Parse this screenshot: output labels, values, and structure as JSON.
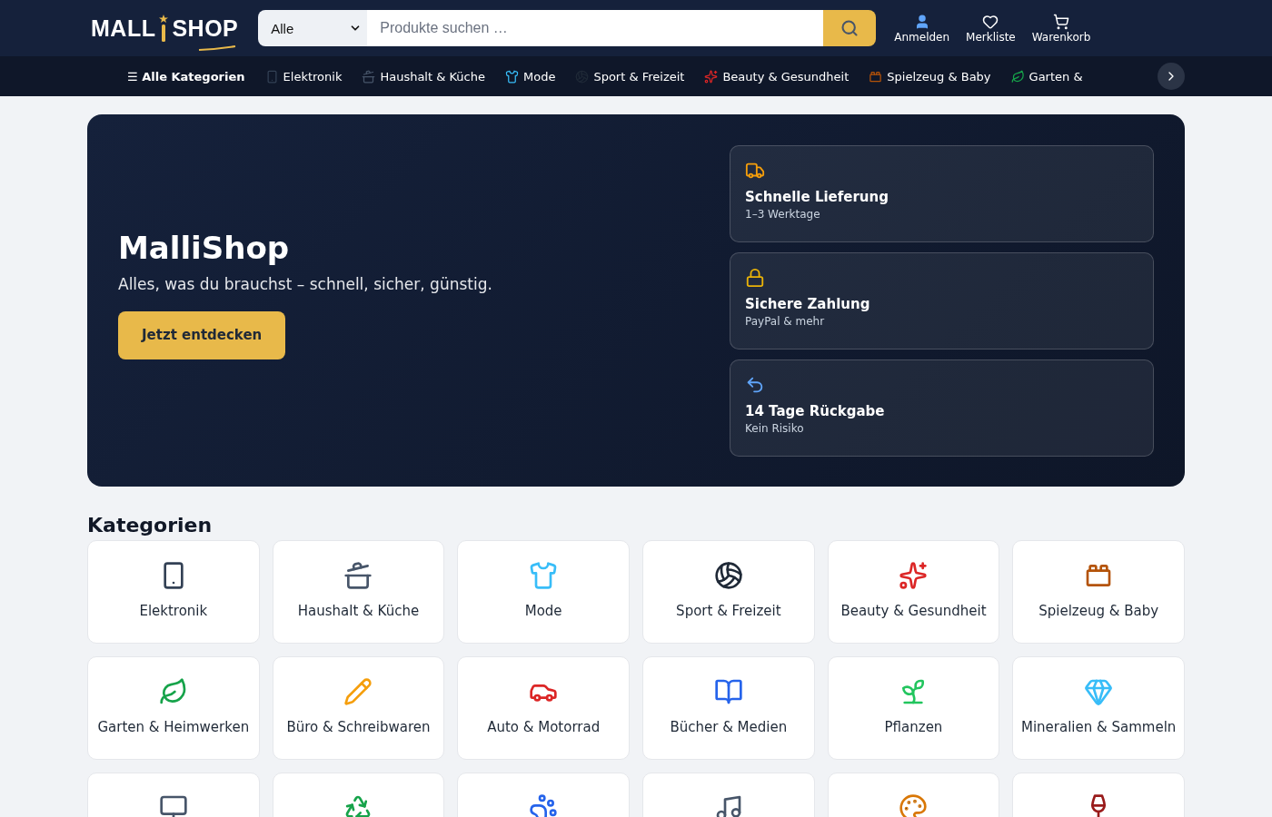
{
  "header": {
    "logo": {
      "left": "MALL",
      "right": "SHOP"
    },
    "search": {
      "category": "Alle",
      "placeholder": "Produkte suchen …"
    },
    "actions": [
      {
        "label": "Anmelden"
      },
      {
        "label": "Merkliste"
      },
      {
        "label": "Warenkorb"
      }
    ]
  },
  "nav": {
    "all": "☰ Alle Kategorien",
    "items": [
      {
        "label": "Elektronik"
      },
      {
        "label": "Haushalt & Küche"
      },
      {
        "label": "Mode"
      },
      {
        "label": "Sport & Freizeit"
      },
      {
        "label": "Beauty & Gesundheit"
      },
      {
        "label": "Spielzeug & Baby"
      },
      {
        "label": "Garten &"
      }
    ]
  },
  "hero": {
    "title": "MalliShop",
    "subtitle": "Alles, was du brauchst – schnell, sicher, günstig.",
    "button": "Jetzt entdecken",
    "features": [
      {
        "title": "Schnelle Lieferung",
        "text": "1–3 Werktage"
      },
      {
        "title": "Sichere Zahlung",
        "text": "PayPal & mehr"
      },
      {
        "title": "14 Tage Rückgabe",
        "text": "Kein Risiko"
      }
    ]
  },
  "categories": {
    "heading": "Kategorien",
    "items": [
      {
        "kind": "labeled",
        "label": "Elektronik"
      },
      {
        "kind": "labeled",
        "label": "Haushalt & Küche"
      },
      {
        "kind": "labeled",
        "label": "Mode"
      },
      {
        "kind": "labeled",
        "label": "Sport & Freizeit"
      },
      {
        "kind": "labeled",
        "label": "Beauty & Gesundheit"
      },
      {
        "kind": "labeled",
        "label": "Spielzeug & Baby"
      },
      {
        "kind": "labeled",
        "label": "Garten & Heimwerken"
      },
      {
        "kind": "labeled",
        "label": "Büro & Schreibwaren"
      },
      {
        "kind": "labeled",
        "label": "Auto & Motorrad"
      },
      {
        "kind": "labeled",
        "label": "Bücher & Medien"
      },
      {
        "kind": "labeled",
        "label": "Pflanzen"
      },
      {
        "kind": "labeled",
        "label": "Mineralien & Sammeln"
      },
      {
        "kind": "cut"
      },
      {
        "kind": "cut"
      },
      {
        "kind": "cut"
      },
      {
        "kind": "cut"
      },
      {
        "kind": "cut"
      },
      {
        "kind": "cut"
      }
    ]
  }
}
